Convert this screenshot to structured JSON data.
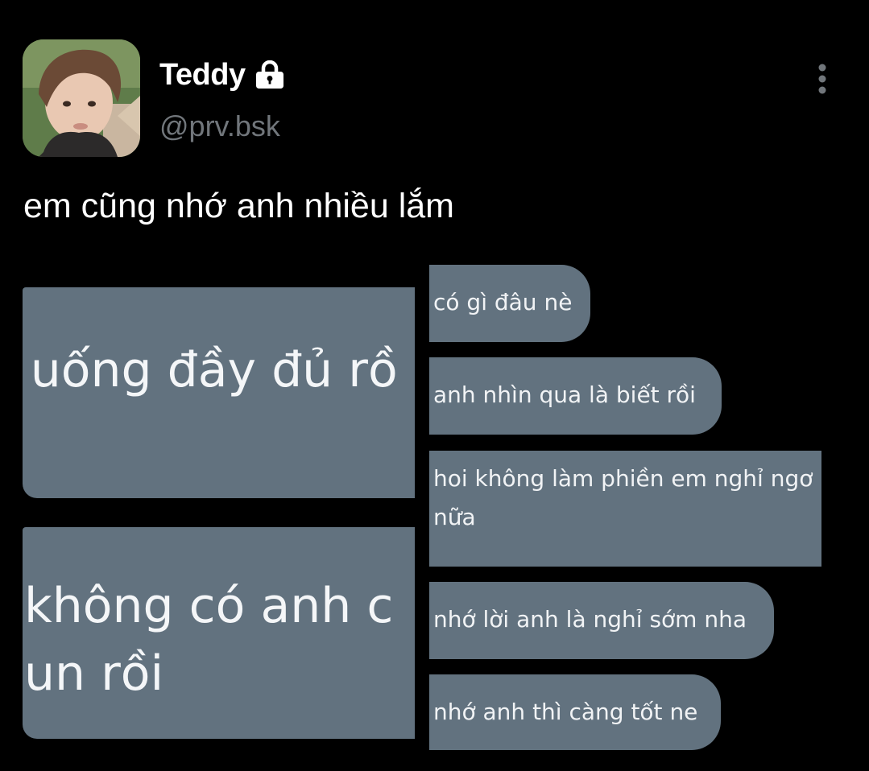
{
  "author": {
    "display_name": "Teddy",
    "handle": "@prv.bsk",
    "avatar_icon": "profile-photo",
    "lock_icon": "lock-icon"
  },
  "tweet": {
    "text": "em cũng nhớ anh nhiều lắm"
  },
  "media": {
    "left_crops": [
      {
        "lines": [
          "ı uống đầy đủ rồ"
        ]
      },
      {
        "lines": [
          "không có anh c",
          "un rồi"
        ]
      }
    ],
    "bubbles": [
      {
        "lines": [
          "có gì đâu nè"
        ]
      },
      {
        "lines": [
          "anh nhìn qua là biết rồi"
        ]
      },
      {
        "lines": [
          "hoi không làm phiền em nghỉ ngơ",
          "nữa"
        ]
      },
      {
        "lines": [
          "nhớ lời anh là nghỉ sớm nha"
        ]
      },
      {
        "lines": [
          "nhớ anh thì càng tốt ne"
        ]
      }
    ],
    "bubble_color": "#62727f"
  },
  "colors": {
    "background": "#000000",
    "text_primary": "#ffffff",
    "text_secondary": "#71767b"
  }
}
